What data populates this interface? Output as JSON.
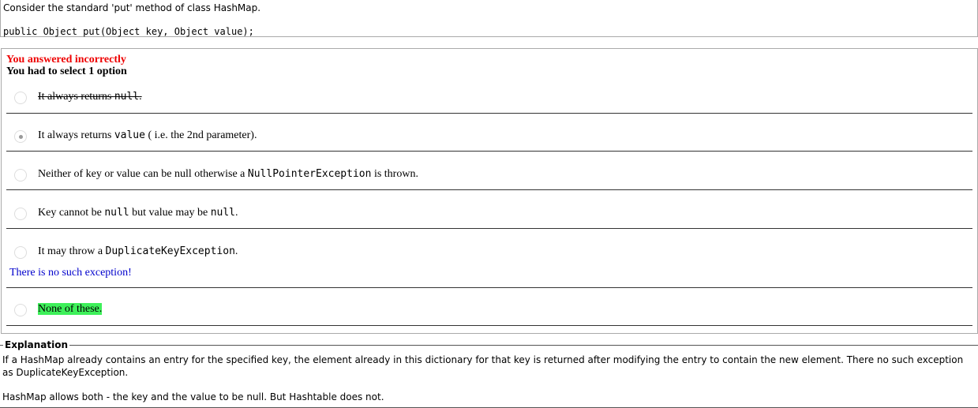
{
  "question": {
    "text": "Consider the standard 'put' method of class HashMap.",
    "code": "public Object put(Object key, Object value);"
  },
  "result": {
    "status": "You answered incorrectly",
    "instruction": "You had to select 1 option"
  },
  "options": {
    "o1": {
      "text": "It always returns ",
      "code": "null",
      "end": "."
    },
    "o2": {
      "text": "It always returns ",
      "code": "value",
      "end": " ( i.e. the 2nd parameter)."
    },
    "o3": {
      "text": "Neither of key or value can be null otherwise a ",
      "code": "NullPointerException",
      "end": " is thrown."
    },
    "o4": {
      "text": "Key cannot be ",
      "code": "null",
      "mid": " but value may be ",
      "code2": "null",
      "end": "."
    },
    "o5": {
      "text": "It may throw a ",
      "code": "DuplicateKeyException",
      "end": ".",
      "feedback": "There is no such exception!"
    },
    "o6": {
      "text": "None of these."
    }
  },
  "explanation": {
    "title": "Explanation",
    "para1": "If a HashMap already contains an entry for the specified key, the element already in this dictionary for that key is returned after modifying the entry to contain the new element. There no such exception as DuplicateKeyException.",
    "para2": "HashMap allows both - the key and the value to  be null. But Hashtable does not."
  },
  "colors": {
    "incorrect": "#ee0000",
    "feedback": "#0000cc",
    "correct_highlight": "#3ef05a"
  }
}
